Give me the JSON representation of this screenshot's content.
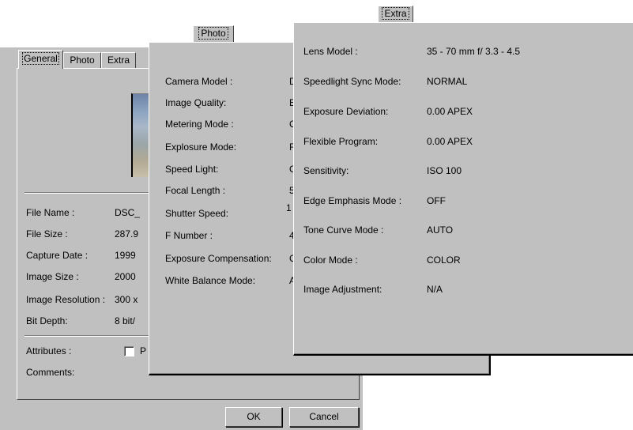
{
  "general": {
    "tabs": [
      {
        "label": "General",
        "active": true
      },
      {
        "label": "Photo",
        "active": false
      },
      {
        "label": "Extra",
        "active": false
      }
    ],
    "fields": [
      {
        "label": "File Name :",
        "value": "DSC_"
      },
      {
        "label": "File Size :",
        "value": "287.9"
      },
      {
        "label": "Capture Date :",
        "value": "1999"
      },
      {
        "label": "Image Size :",
        "value": "2000"
      },
      {
        "label": "Image Resolution :",
        "value": "300 x"
      },
      {
        "label": "Bit Depth:",
        "value": "8 bit/"
      }
    ],
    "attributes_label": "Attributes :",
    "attribute_checkbox_label": "P",
    "comments_label": "Comments:",
    "ok_label": "OK",
    "cancel_label": "Cancel"
  },
  "photo": {
    "title": "Photo",
    "fields": [
      {
        "label": "Camera Model :",
        "value": "D"
      },
      {
        "label": "Image Quality:",
        "value": "E"
      },
      {
        "label": "Metering Mode :",
        "value": "C"
      },
      {
        "label": "Explosure Mode:",
        "value": "F"
      },
      {
        "label": "Speed Light:",
        "value": "C"
      },
      {
        "label": "Focal Length :",
        "value": "5"
      },
      {
        "label": "Shutter Speed:",
        "value": "1"
      },
      {
        "label": "F Number :",
        "value": "4"
      },
      {
        "label": "Exposure Compensation:",
        "value": "C"
      },
      {
        "label": "White Balance Mode:",
        "value": "A"
      }
    ]
  },
  "extra": {
    "title": "Extra",
    "fields": [
      {
        "label": "Lens Model :",
        "value": "35 - 70 mm f/ 3.3 - 4.5"
      },
      {
        "label": "Speedlight Sync Mode:",
        "value": "NORMAL"
      },
      {
        "label": "Exposure Deviation:",
        "value": "0.00 APEX"
      },
      {
        "label": "Flexible Program:",
        "value": "0.00 APEX"
      },
      {
        "label": "Sensitivity:",
        "value": "ISO 100"
      },
      {
        "label": "Edge Emphasis Mode :",
        "value": "OFF"
      },
      {
        "label": "Tone Curve Mode :",
        "value": "AUTO"
      },
      {
        "label": "Color Mode :",
        "value": "COLOR"
      },
      {
        "label": "Image Adjustment:",
        "value": "N/A"
      }
    ]
  }
}
